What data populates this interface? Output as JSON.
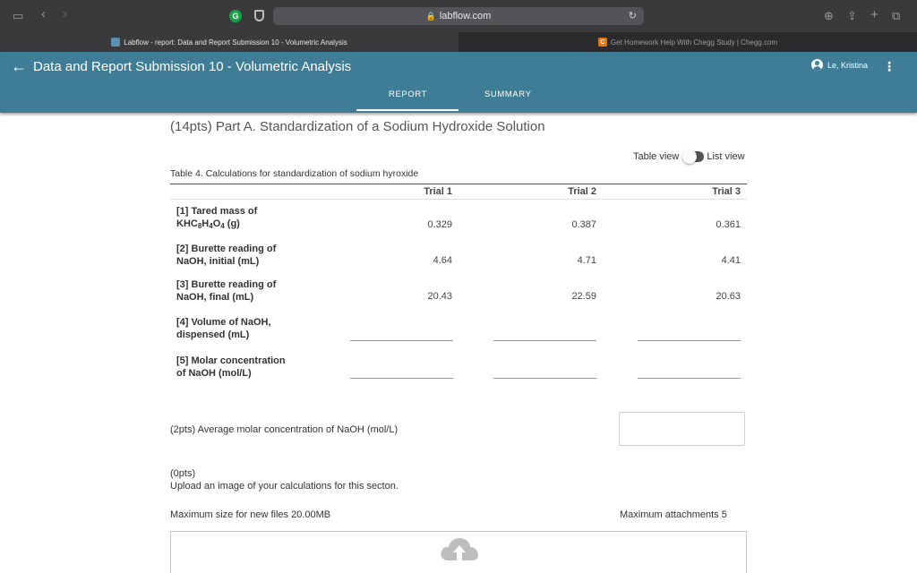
{
  "browser": {
    "url": "labflow.com",
    "tabs": [
      {
        "label": "Labflow - report: Data and Report Submission 10 - Volumetric Analysis",
        "active": true
      },
      {
        "label": "Get Homework Help With Chegg Study | Chegg.com",
        "active": false
      }
    ],
    "ext_g_label": "G",
    "chegg_fav_label": "C"
  },
  "header": {
    "title": "Data and Report Submission 10 - Volumetric Analysis",
    "user": "Le, Kristina",
    "tabs": [
      "REPORT",
      "SUMMARY"
    ],
    "active_tab": "REPORT",
    "accent": "#3e7d95"
  },
  "section": {
    "title": "(14pts) Part A. Standardization of a Sodium Hydroxide Solution",
    "view_toggle": {
      "left": "Table view",
      "right": "List view"
    }
  },
  "table": {
    "caption": "Table 4. Calculations for standardization of sodium hyroxide",
    "columns": [
      "Trial 1",
      "Trial 2",
      "Trial 3"
    ],
    "rows": [
      {
        "label_line1": "[1] Tared mass of",
        "label_line2_pre": "KHC",
        "label_line2_sub1": "8",
        "label_line2_mid": "H",
        "label_line2_sub2": "4",
        "label_line2_mid2": "O",
        "label_line2_sub3": "4",
        "label_line2_post": " (g)",
        "values": [
          "0.329",
          "0.387",
          "0.361"
        ]
      },
      {
        "label_line1": "[2] Burette reading of",
        "label_line2": "NaOH, initial (mL)",
        "values": [
          "4.64",
          "4.71",
          "4.41"
        ]
      },
      {
        "label_line1": "[3] Burette reading of",
        "label_line2": "NaOH, final (mL)",
        "values": [
          "20.43",
          "22.59",
          "20.63"
        ]
      },
      {
        "label_line1": "[4] Volume of NaOH,",
        "label_line2": "dispensed (mL)",
        "values": [
          "",
          "",
          ""
        ]
      },
      {
        "label_line1": "[5] Molar concentration",
        "label_line2": "of NaOH (mol/L)",
        "values": [
          "",
          "",
          ""
        ]
      }
    ]
  },
  "average": {
    "label": "(2pts)  Average molar concentration of NaOH (mol/L)",
    "value": ""
  },
  "upload": {
    "points": "(0pts)",
    "description": "Upload an image of your calculations for this secton.",
    "max_size": "Maximum size for new files   20.00MB",
    "max_attachments": "Maximum attachments   5"
  }
}
